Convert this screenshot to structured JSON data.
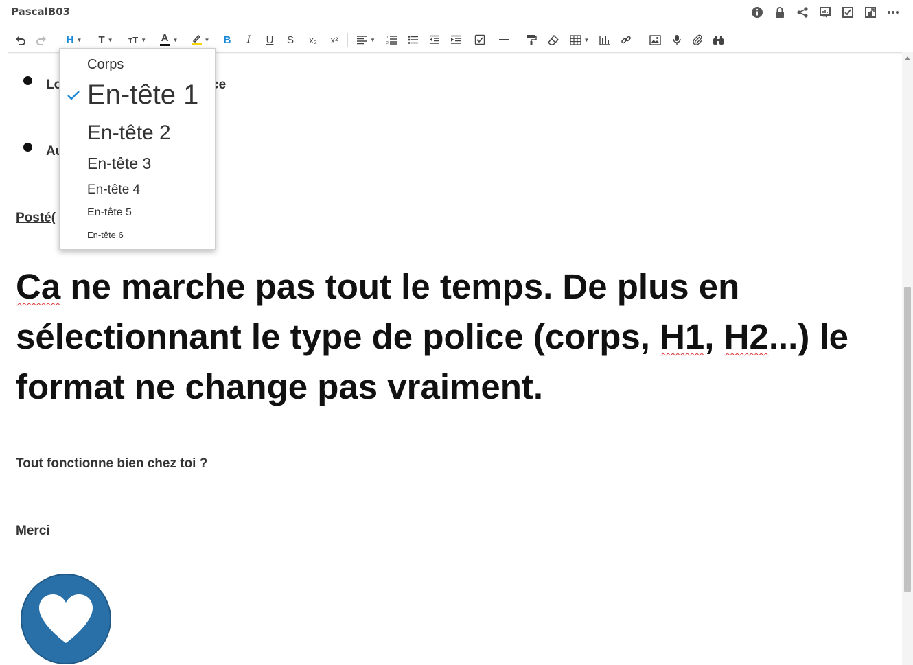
{
  "header": {
    "title": "PascalB03",
    "icons": [
      "info-icon",
      "lock-icon",
      "share-icon",
      "presentation-icon",
      "checkbox-icon",
      "external-link-icon",
      "more-icon"
    ]
  },
  "toolbar": {
    "heading_button": "H",
    "text_button": "T",
    "font_size_button": "тT",
    "font_color_button": "A",
    "bold": "B",
    "italic": "I",
    "underline": "U",
    "strike": "S",
    "subscript": "x₂",
    "superscript": "x²",
    "colors": {
      "accent": "#1a8ad6",
      "font_color_bar": "#111111",
      "highlight_bar": "#f5d60a"
    }
  },
  "dropdown": {
    "selected": "En-tête 1",
    "items": [
      {
        "label": "Corps"
      },
      {
        "label": "En-tête 1"
      },
      {
        "label": "En-tête 2"
      },
      {
        "label": "En-tête 3"
      },
      {
        "label": "En-tête 4"
      },
      {
        "label": "En-tête 5"
      },
      {
        "label": "En-tête 6"
      }
    ]
  },
  "content": {
    "bullets": [
      {
        "visible_start": "Lo",
        "visible_end": "ce"
      },
      {
        "visible_start": "Au"
      }
    ],
    "posted_prefix": "Posté(",
    "big_paragraph": {
      "w1": "Ca",
      "t1": " ne marche pas tout le temps. De plus en sélectionnant le type de police (corps, ",
      "w2": "H1",
      "t2": ", ",
      "w3": "H2",
      "t3": "...) le format ne change pas vraiment."
    },
    "question": "Tout fonctionne bien chez toi ?",
    "thanks": "Merci"
  }
}
